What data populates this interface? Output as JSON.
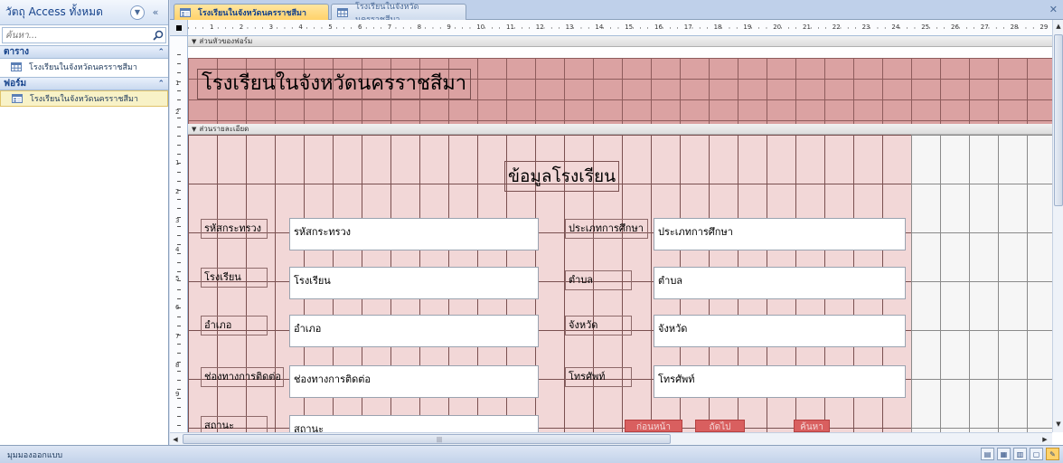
{
  "nav": {
    "title": "วัตถุ Access ทั้งหมด",
    "search_placeholder": "ค้นหา...",
    "groups": [
      {
        "label": "ตาราง",
        "items": [
          {
            "label": "โรงเรียนในจังหวัดนครราชสีมา"
          }
        ]
      },
      {
        "label": "ฟอร์ม",
        "items": [
          {
            "label": "โรงเรียนในจังหวัดนครราชสีมา"
          }
        ]
      }
    ]
  },
  "tabs": [
    {
      "label": "โรงเรียนในจังหวัดนครราชสีมา",
      "active": true,
      "icon": "form-icon"
    },
    {
      "label": "โรงเรียนในจังหวัดนครราชสีมา",
      "active": false,
      "icon": "table-icon"
    }
  ],
  "ruler": {
    "h_numbers": [
      "1",
      "2",
      "3",
      "4",
      "5",
      "6",
      "7",
      "8",
      "9",
      "10",
      "11",
      "12",
      "13",
      "14",
      "15",
      "16",
      "17",
      "18",
      "19",
      "20",
      "21",
      "22",
      "23",
      "24",
      "25",
      "26",
      "27",
      "28",
      "29"
    ],
    "v_numbers_header": [
      "1",
      "2"
    ],
    "v_numbers_detail": [
      "1",
      "2",
      "3",
      "4",
      "5",
      "6",
      "7",
      "8",
      "9"
    ]
  },
  "sections": {
    "header": "ส่วนหัวของฟอร์ม",
    "detail": "ส่วนรายละเอียด"
  },
  "form": {
    "title": "โรงเรียนในจังหวัดนครราชสีมา",
    "detail_title": "ข้อมูลโรงเรียน",
    "fields": [
      {
        "label": "รหัสกระทรวง",
        "value": "รหัสกระทรวง"
      },
      {
        "label": "ประเภทการศึกษา",
        "value": "ประเภทการศึกษา"
      },
      {
        "label": "โรงเรียน",
        "value": "โรงเรียน"
      },
      {
        "label": "ตำบล",
        "value": "ตำบล"
      },
      {
        "label": "อำเภอ",
        "value": "อำเภอ"
      },
      {
        "label": "จังหวัด",
        "value": "จังหวัด"
      },
      {
        "label": "ช่องทางการติดต่อ",
        "value": "ช่องทางการติดต่อ"
      },
      {
        "label": "โทรศัพท์",
        "value": "โทรศัพท์"
      },
      {
        "label": "สถานะ",
        "value": "สถานะ"
      }
    ],
    "buttons": [
      {
        "label": "ก่อนหน้า"
      },
      {
        "label": "ถัดไป"
      },
      {
        "label": "ค้นหา"
      }
    ]
  },
  "status": {
    "text": "มุมมองออกแบบ"
  },
  "colors": {
    "header_bg": "#dba2a2",
    "detail_bg": "#f2d7d7",
    "button_bg": "#d95f5f",
    "active_tab": "#ffd26a"
  }
}
